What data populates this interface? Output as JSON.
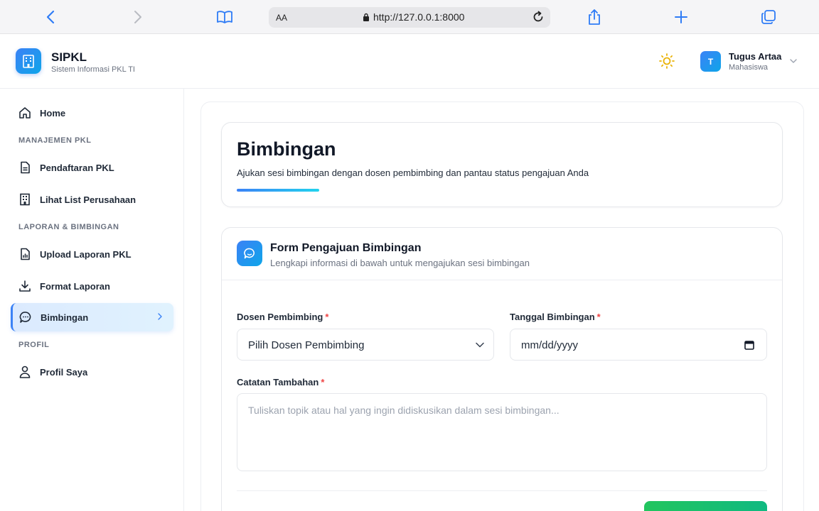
{
  "browser": {
    "aa_label": "AA",
    "url": "http://127.0.0.1:8000"
  },
  "header": {
    "brand_name": "SIPKL",
    "brand_subtitle": "Sistem Informasi PKL TI",
    "user_initial": "T",
    "user_name": "Tugus Artaa",
    "user_role": "Mahasiswa"
  },
  "sidebar": {
    "home": "Home",
    "section_manajemen": "MANAJEMEN PKL",
    "pendaftaran": "Pendaftaran PKL",
    "lihat_list": "Lihat List Perusahaan",
    "section_laporan": "LAPORAN & BIMBINGAN",
    "upload_laporan": "Upload Laporan PKL",
    "format_laporan": "Format Laporan",
    "bimbingan": "Bimbingan",
    "section_profil": "PROFIL",
    "profil_saya": "Profil Saya"
  },
  "page": {
    "title": "Bimbingan",
    "subtitle": "Ajukan sesi bimbingan dengan dosen pembimbing dan pantau status pengajuan Anda"
  },
  "form": {
    "title": "Form Pengajuan Bimbingan",
    "subtitle": "Lengkapi informasi di bawah untuk mengajukan sesi bimbingan",
    "dosen_label": "Dosen Pembimbing",
    "dosen_value": "Pilih Dosen Pembimbing",
    "tanggal_label": "Tanggal Bimbingan",
    "tanggal_value": "mm/dd/yyyy",
    "catatan_label": "Catatan Tambahan",
    "catatan_placeholder": "Tuliskan topik atau hal yang ingin didiskusikan dalam sesi bimbingan...",
    "required_mark": "*"
  },
  "colors": {
    "accent": "#3b82f6",
    "required": "#ef4444",
    "submit": "#22c55e"
  }
}
